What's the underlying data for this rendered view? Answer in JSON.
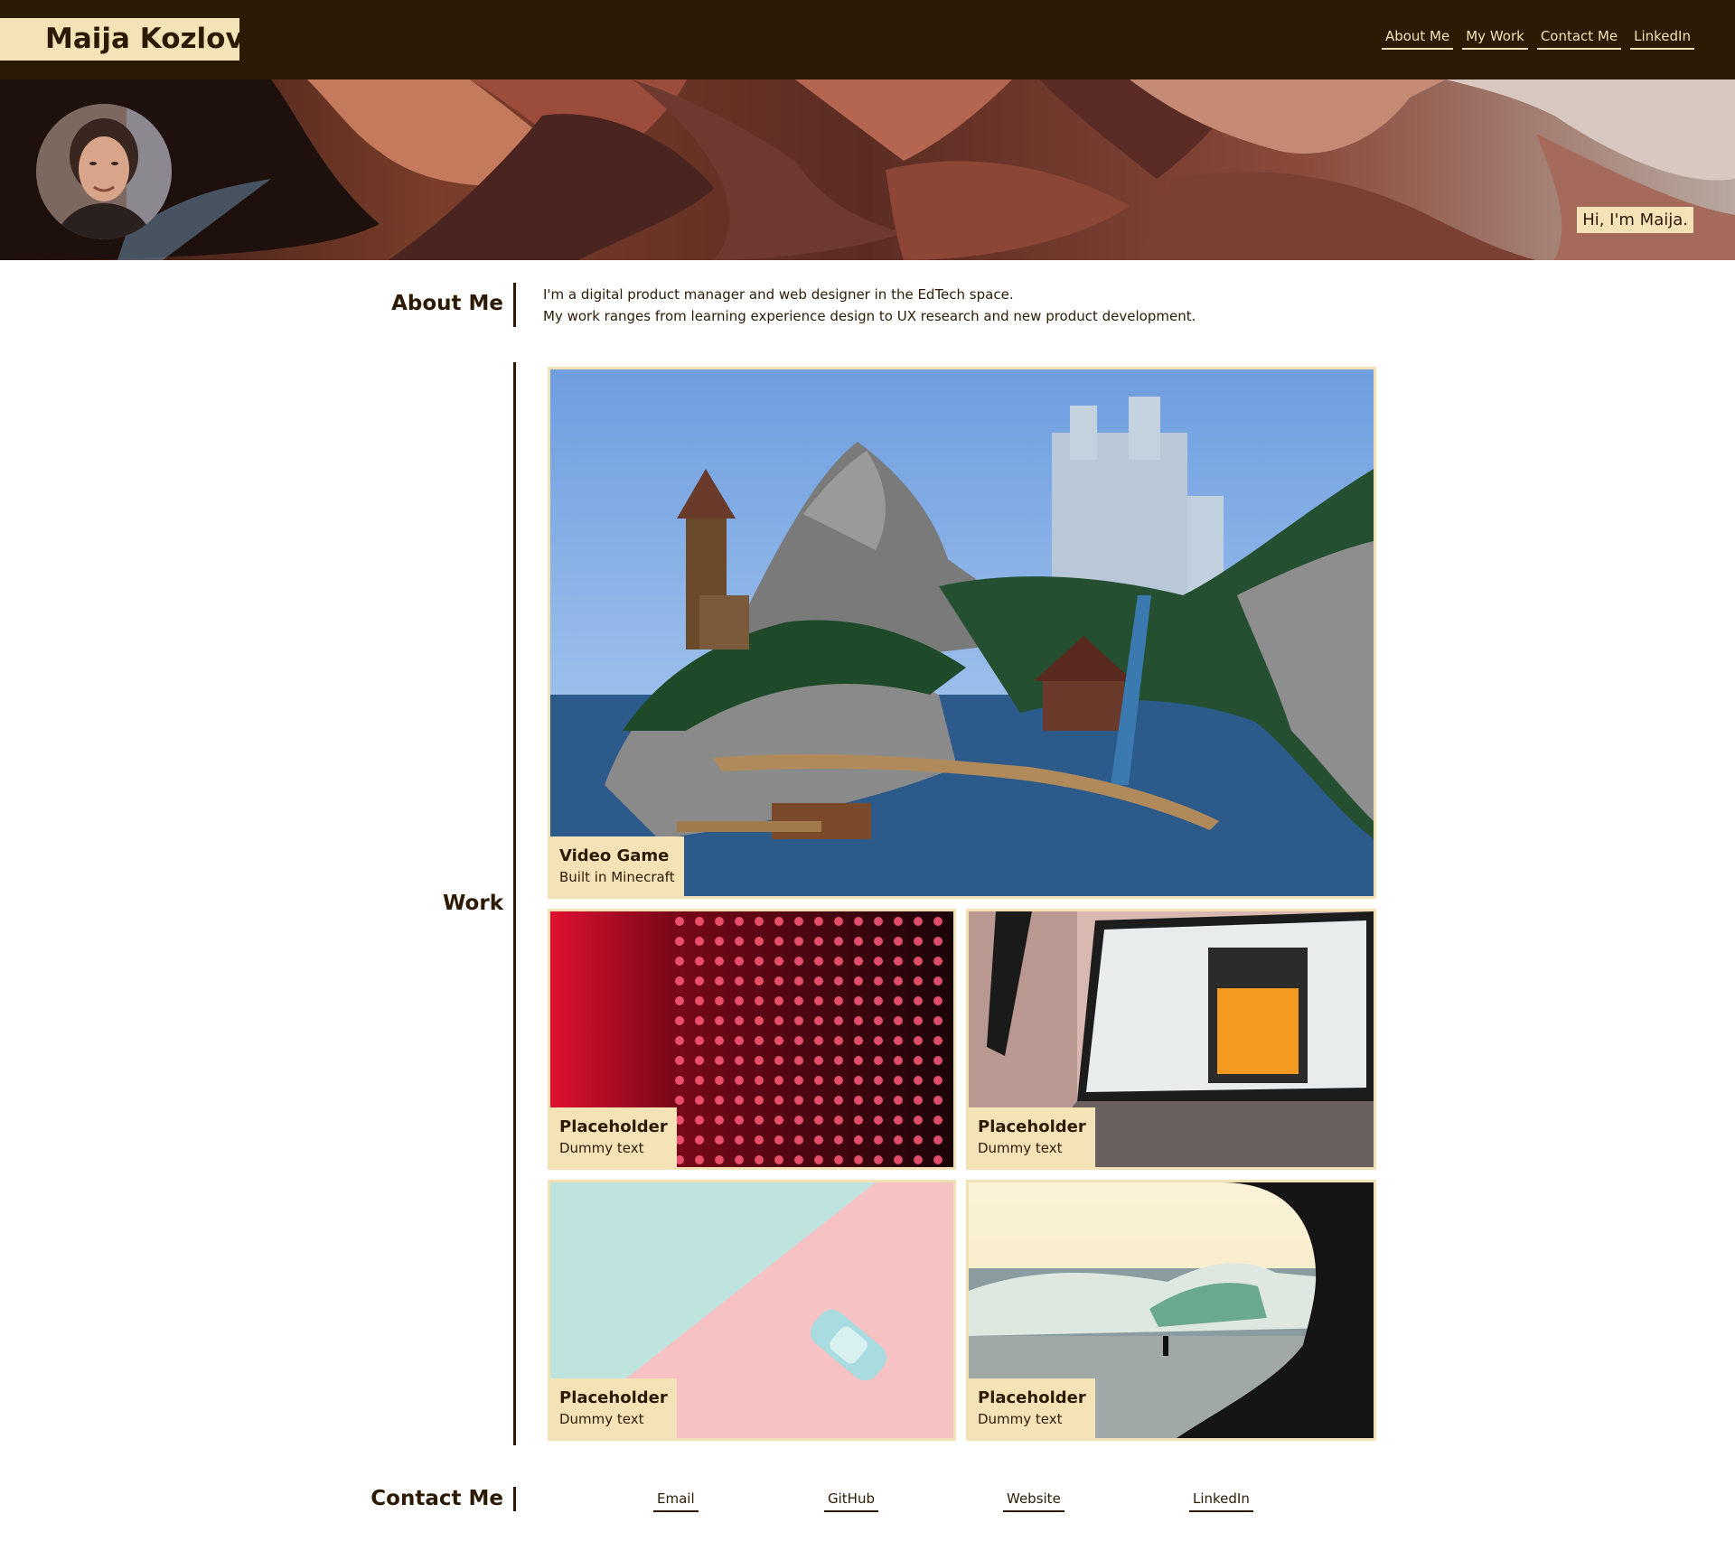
{
  "header": {
    "name": "Maija Kozlova",
    "nav": [
      "About Me",
      "My Work",
      "Contact Me",
      "LinkedIn"
    ]
  },
  "hero": {
    "greeting": "Hi, I'm Maija."
  },
  "about": {
    "heading": "About Me",
    "lines": [
      "I'm a digital product manager and web designer in the EdTech space.",
      "My work ranges from learning experience design to UX research and new product development."
    ]
  },
  "work": {
    "heading": "Work",
    "cards": [
      {
        "title": "Video Game",
        "subtitle": "Built in Minecraft"
      },
      {
        "title": "Placeholder",
        "subtitle": "Dummy text"
      },
      {
        "title": "Placeholder",
        "subtitle": "Dummy text"
      },
      {
        "title": "Placeholder",
        "subtitle": "Dummy text"
      },
      {
        "title": "Placeholder",
        "subtitle": "Dummy text"
      }
    ]
  },
  "contact": {
    "heading": "Contact Me",
    "links": [
      "Email",
      "GitHub",
      "Website",
      "LinkedIn"
    ]
  },
  "colors": {
    "header_bg": "#2c1a05",
    "accent": "#f5e3b8",
    "card_border": "#f1e1b5"
  }
}
